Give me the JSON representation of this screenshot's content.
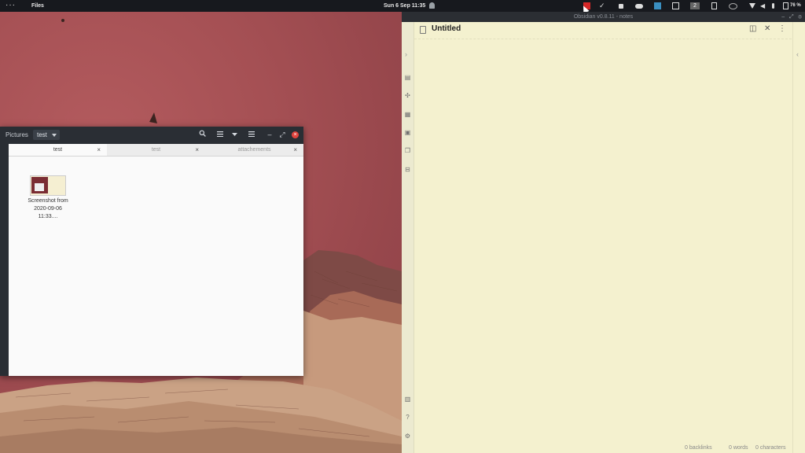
{
  "topbar": {
    "activities": "···",
    "app_name": "Files",
    "clock": "Sun 6 Sep  11:35",
    "battery": "76 %"
  },
  "files_window": {
    "breadcrumbs": [
      "Pictures",
      "test"
    ],
    "tabs": [
      {
        "label": "test",
        "active": true
      },
      {
        "label": "test",
        "active": false
      },
      {
        "label": "attachements",
        "active": false
      }
    ],
    "items": [
      {
        "name": "Screenshot from 2020-09-06 11:33...."
      }
    ]
  },
  "obsidian": {
    "window_title": "Obsidian v0.8.11 - notes",
    "note_title": "Untitled",
    "status": {
      "backlinks": "0 backlinks",
      "words": "0 words",
      "characters": "0 characters"
    }
  },
  "colors": {
    "wallpaper": "#a55054",
    "obsidian_bg": "#f4f1cf",
    "panel": "#17191e",
    "close_red": "#e0443e"
  }
}
